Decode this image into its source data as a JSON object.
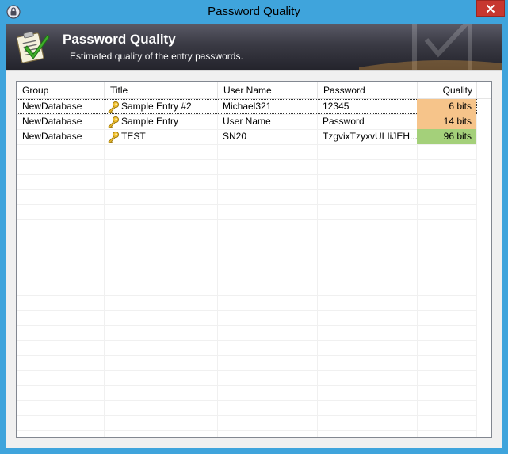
{
  "window": {
    "title": "Password Quality"
  },
  "banner": {
    "title": "Password Quality",
    "subtitle": "Estimated quality of the entry passwords."
  },
  "columns": [
    "Group",
    "Title",
    "User Name",
    "Password",
    "Quality"
  ],
  "rows": [
    {
      "group": "NewDatabase",
      "title": "Sample Entry #2",
      "username": "Michael321",
      "password": "12345",
      "quality": "6 bits",
      "quality_color": "#f6c48a"
    },
    {
      "group": "NewDatabase",
      "title": "Sample Entry",
      "username": "User Name",
      "password": "Password",
      "quality": "14 bits",
      "quality_color": "#f6c48a"
    },
    {
      "group": "NewDatabase",
      "title": "TEST",
      "username": "SN20",
      "password": "TzgvixTzyxvULIiJEH...",
      "quality": "96 bits",
      "quality_color": "#a4d07a"
    }
  ],
  "icons": {
    "app": "lock-icon",
    "close": "close-icon",
    "banner": "checklist-icon",
    "entry": "key-icon"
  },
  "colors": {
    "titlebar": "#3fa4dc",
    "close_button": "#c7372f",
    "weak_quality": "#f6c48a",
    "strong_quality": "#a4d07a"
  }
}
